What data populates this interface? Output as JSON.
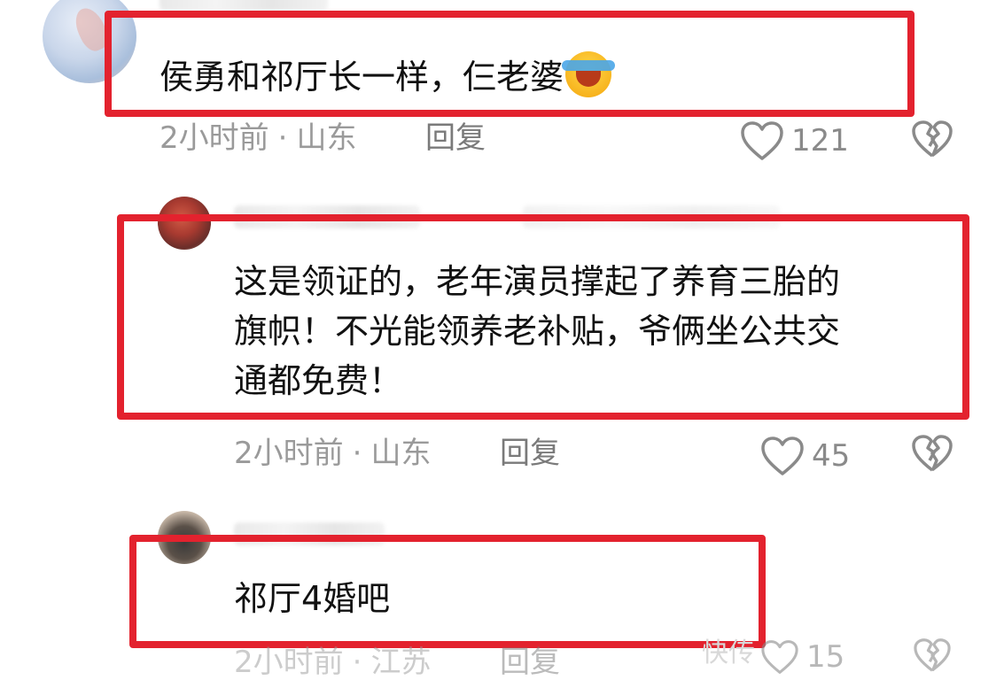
{
  "comments": [
    {
      "text": "侯勇和祁厅长一样，仨老婆",
      "time": "2小时前",
      "location": "山东",
      "reply_label": "回复",
      "likes": "121"
    },
    {
      "text": "这是领证的，老年演员撑起了养育三胎的\n旗帜！不光能领养老补贴，爷俩坐公共交\n通都免费！",
      "time": "2小时前",
      "location": "山东",
      "reply_label": "回复",
      "likes": "45"
    },
    {
      "text": "祁厅4婚吧",
      "time": "2小时前",
      "location": "江苏",
      "reply_label": "回复",
      "likes": "15"
    }
  ],
  "separator": "·",
  "watermark": "快传",
  "colors": {
    "highlight": "#e3222e",
    "meta": "#9a9a9a"
  }
}
